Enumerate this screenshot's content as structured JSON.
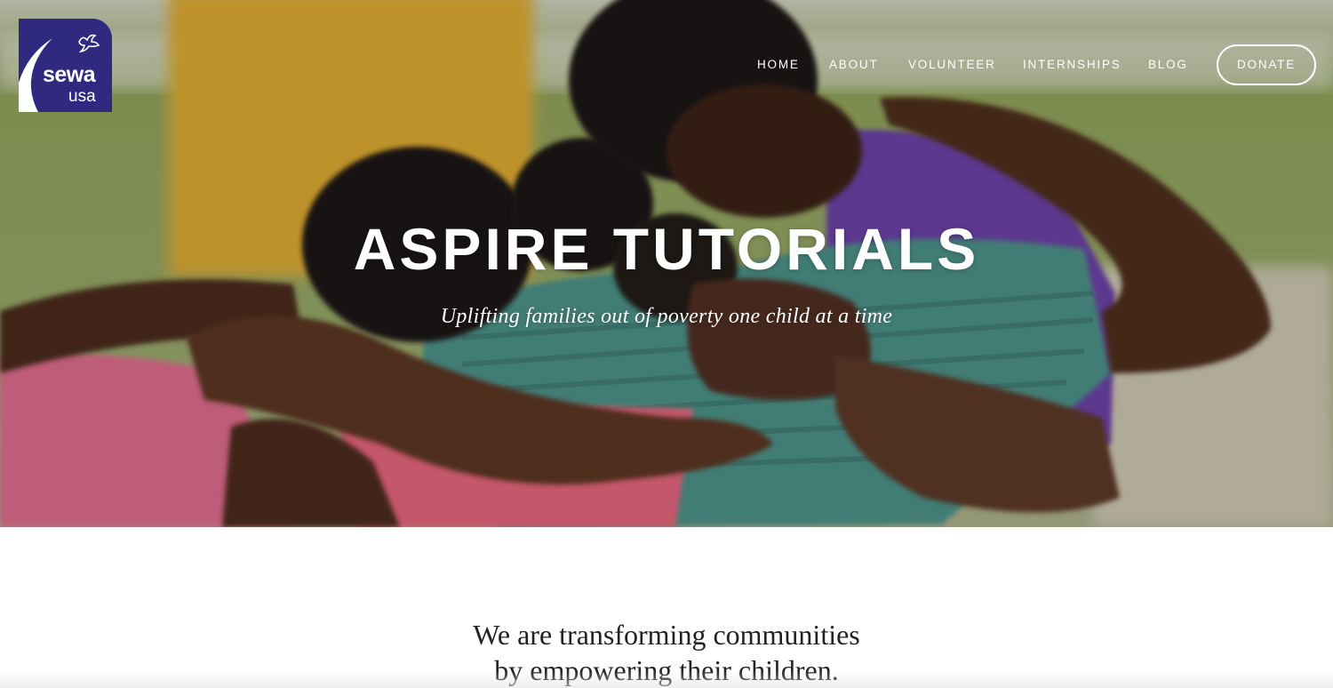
{
  "brand": {
    "logo_word": "sewa",
    "logo_region": "usa",
    "logo_color": "#2f2a7f"
  },
  "nav": {
    "items": [
      {
        "label": "HOME"
      },
      {
        "label": "ABOUT"
      },
      {
        "label": "VOLUNTEER"
      },
      {
        "label": "INTERNSHIPS"
      },
      {
        "label": "BLOG"
      }
    ],
    "donate_label": "DONATE"
  },
  "hero": {
    "title": "ASPIRE TUTORIALS",
    "subtitle": "Uplifting families out of poverty one child at a time"
  },
  "intro": {
    "line1": "We are transforming communities",
    "line2": "by empowering their children."
  },
  "icons": {
    "logo": "dove-icon"
  }
}
